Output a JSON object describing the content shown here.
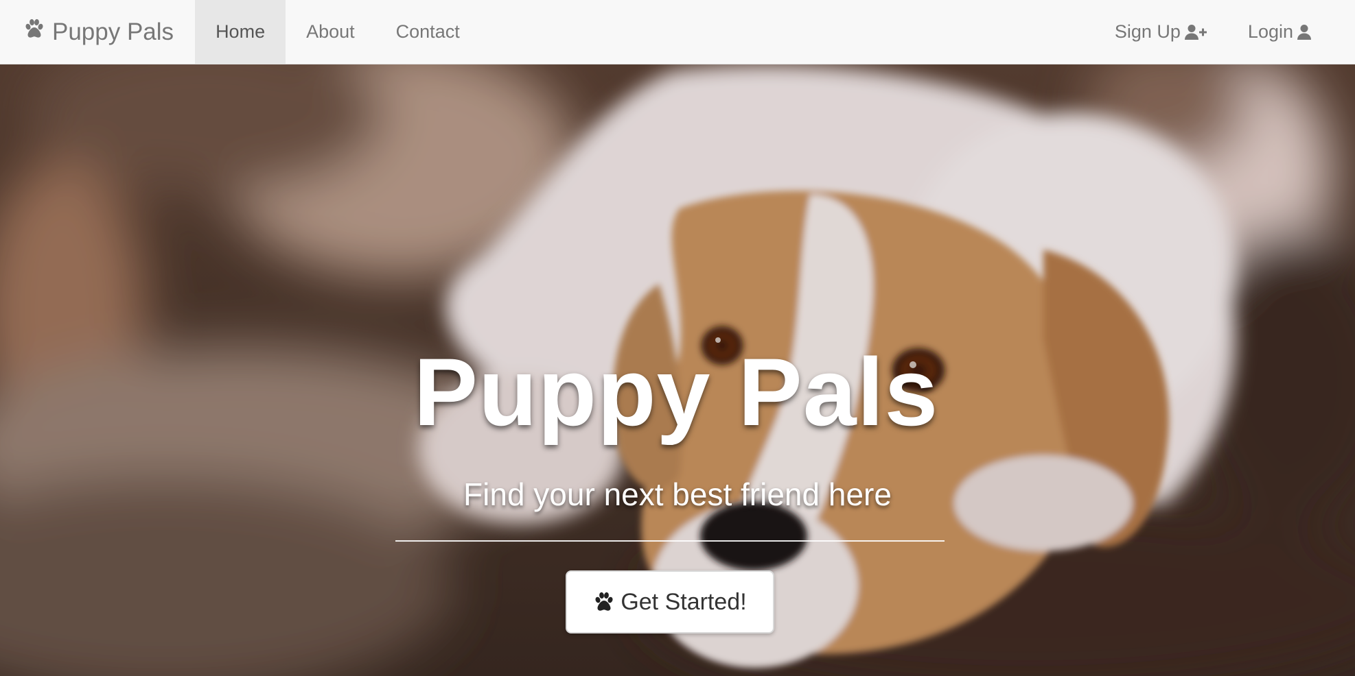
{
  "navbar": {
    "brand_label": "Puppy Pals",
    "brand_icon": "paw-icon",
    "items": [
      {
        "label": "Home",
        "active": true
      },
      {
        "label": "About",
        "active": false
      },
      {
        "label": "Contact",
        "active": false
      }
    ],
    "right_items": [
      {
        "label": "Sign Up",
        "icon": "user-plus-icon"
      },
      {
        "label": "Login",
        "icon": "user-icon"
      }
    ]
  },
  "hero": {
    "title": "Puppy Pals",
    "subtitle": "Find your next best friend here",
    "cta_label": "Get Started!",
    "cta_icon": "paw-icon"
  },
  "colors": {
    "navbar_bg": "#f8f8f8",
    "nav_text": "#777777",
    "nav_active_bg": "#e7e7e7",
    "hero_text": "#ffffff"
  }
}
